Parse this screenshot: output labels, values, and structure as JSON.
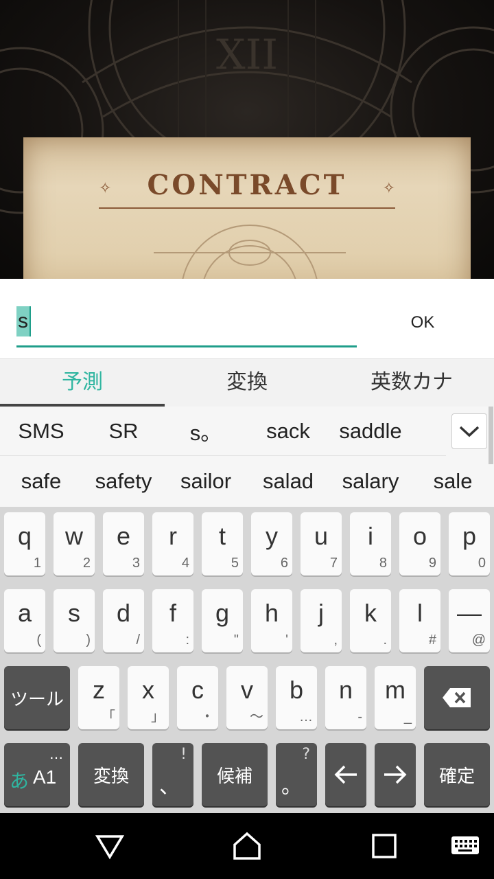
{
  "background": {
    "title": "CONTRACT",
    "numeral": "XII"
  },
  "dialog": {
    "input_value": "s",
    "ok_label": "OK"
  },
  "ime_tabs": [
    {
      "label": "予測",
      "active": true
    },
    {
      "label": "変換",
      "active": false
    },
    {
      "label": "英数カナ",
      "active": false
    }
  ],
  "candidates": {
    "row1": [
      "SMS",
      "SR",
      "s。",
      "sack",
      "saddle"
    ],
    "row2": [
      "safe",
      "safety",
      "sailor",
      "salad",
      "salary",
      "sale"
    ]
  },
  "keyboard": {
    "row1": [
      {
        "main": "q",
        "sub": "1"
      },
      {
        "main": "w",
        "sub": "2"
      },
      {
        "main": "e",
        "sub": "3"
      },
      {
        "main": "r",
        "sub": "4"
      },
      {
        "main": "t",
        "sub": "5"
      },
      {
        "main": "y",
        "sub": "6"
      },
      {
        "main": "u",
        "sub": "7"
      },
      {
        "main": "i",
        "sub": "8"
      },
      {
        "main": "o",
        "sub": "9"
      },
      {
        "main": "p",
        "sub": "0"
      }
    ],
    "row2": [
      {
        "main": "a",
        "sub": "("
      },
      {
        "main": "s",
        "sub": ")"
      },
      {
        "main": "d",
        "sub": "/"
      },
      {
        "main": "f",
        "sub": ":"
      },
      {
        "main": "g",
        "sub": "\""
      },
      {
        "main": "h",
        "sub": "'"
      },
      {
        "main": "j",
        "sub": ","
      },
      {
        "main": "k",
        "sub": "."
      },
      {
        "main": "l",
        "sub": "#"
      },
      {
        "main": "—",
        "sub": "@"
      }
    ],
    "row3": {
      "tool": "ツール",
      "letters": [
        {
          "main": "z",
          "sub": "「"
        },
        {
          "main": "x",
          "sub": "」"
        },
        {
          "main": "c",
          "sub": "・"
        },
        {
          "main": "v",
          "sub": "～"
        },
        {
          "main": "b",
          "sub": "…"
        },
        {
          "main": "n",
          "sub": "-"
        },
        {
          "main": "m",
          "sub": "_"
        }
      ]
    },
    "row4": {
      "mode_kana": "あ",
      "mode_alpha": "A1",
      "mode_more": "…",
      "convert": "変換",
      "comma": "、",
      "comma_sub": "!",
      "candidates": "候補",
      "period": "。",
      "period_sub": "?",
      "confirm": "確定"
    }
  },
  "colors": {
    "accent": "#2fb5a0",
    "input_underline": "#1f9e8a",
    "dark_key": "#535353"
  }
}
